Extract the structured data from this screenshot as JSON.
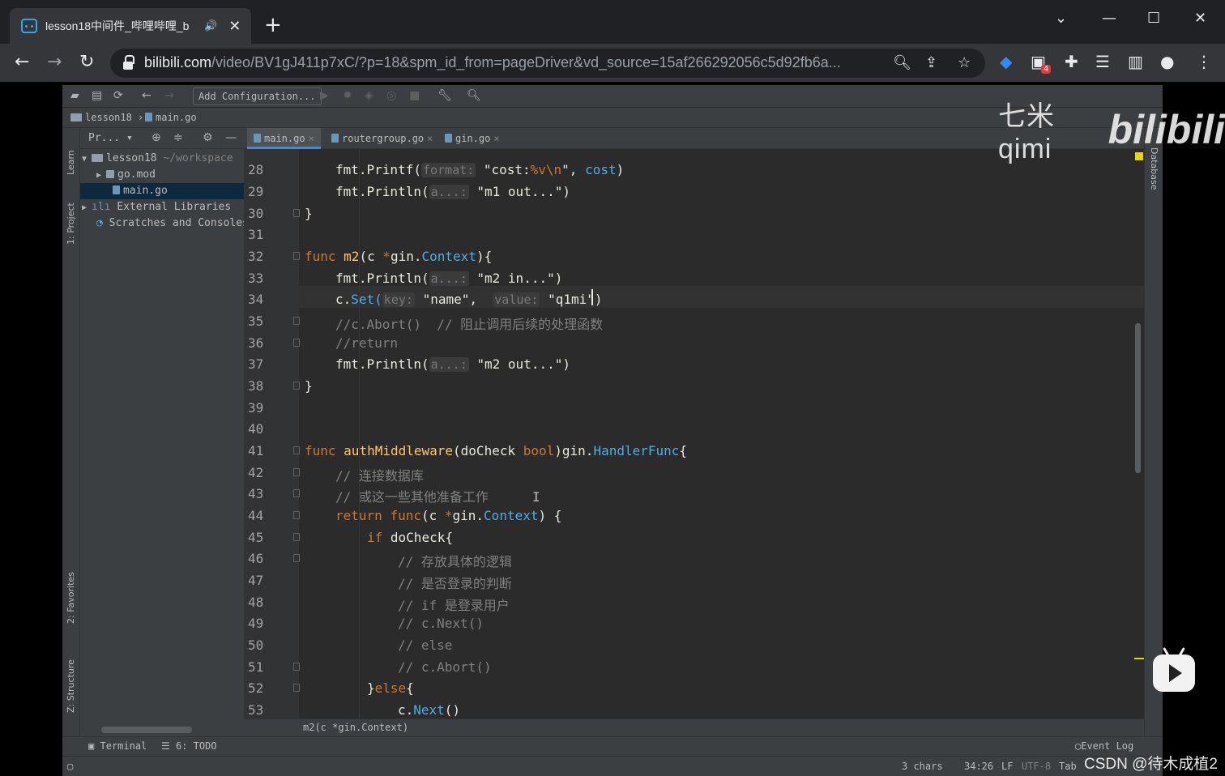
{
  "browser": {
    "tab_title": "lesson18中间件_哔哩哔哩_b",
    "url_host": "bilibili.com",
    "url_path": "/video/BV1gJ411p7xC/?p=18&spm_id_from=pageDriver&vd_source=15af266292056c5d92fb6a...",
    "extension_badge": "4"
  },
  "ide": {
    "toolbar": {
      "add_configuration": "Add Configuration..."
    },
    "nav": {
      "project": "lesson18",
      "file": "main.go"
    },
    "left_stripe": {
      "learn": "Learn",
      "project": "1: Project",
      "favorites": "2: Favorites",
      "structure": "Z: Structure"
    },
    "right_stripe": {
      "database": "Database"
    },
    "project_panel": {
      "title": "Pr...",
      "tree": [
        {
          "arrow": "▼",
          "name": "lesson18",
          "hint": " ~/workspace"
        },
        {
          "arrow": "▶",
          "name": "go.mod",
          "hint": ""
        },
        {
          "arrow": "",
          "name": "main.go",
          "hint": ""
        },
        {
          "arrow": "▶",
          "name": "External Libraries",
          "hint": ""
        },
        {
          "arrow": "",
          "name": "Scratches and Consoles",
          "hint": ""
        }
      ]
    },
    "tabs": [
      "main.go",
      "routergroup.go",
      "gin.go"
    ],
    "line_numbers": [
      "28",
      "29",
      "30",
      "31",
      "32",
      "33",
      "34",
      "35",
      "36",
      "37",
      "38",
      "39",
      "40",
      "41",
      "42",
      "43",
      "44",
      "45",
      "46",
      "47",
      "48",
      "49",
      "50",
      "51",
      "52",
      "53"
    ],
    "code": {
      "l28": {
        "pkg": "fmt.",
        "fn": "Printf(",
        "hint": "format:",
        "s1": "\"cost:",
        "esc": "%v\\n",
        "s2": "\"",
        "rest": ", ",
        "var": "cost",
        "end": ")"
      },
      "l29": {
        "pkg": "fmt.",
        "fn": "Println(",
        "hint": "a...:",
        "str": "\"m1 out...\"",
        "end": ")"
      },
      "l30": "}",
      "l32": {
        "kw": "func ",
        "fn": "m2",
        "p1": "(c ",
        "star": "*",
        "pkg": "gin.",
        "typ": "Context",
        "end": "){"
      },
      "l33": {
        "pkg": "fmt.",
        "fn": "Println(",
        "hint": "a...:",
        "str": "\"m2 in...\"",
        "end": ")"
      },
      "l34": {
        "pkg": "c.",
        "fn": "Set(",
        "hint1": "key:",
        "str1": "\"name\"",
        "comma": ",",
        "hint2": "value:",
        "str2": "\"q1mi\"",
        "end": ")"
      },
      "l35": "//c.Abort()  // 阻止调用后续的处理函数",
      "l36": "//return",
      "l37": {
        "pkg": "fmt.",
        "fn": "Println(",
        "hint": "a...:",
        "str": "\"m2 out...\"",
        "end": ")"
      },
      "l38": "}",
      "l41": {
        "kw": "func ",
        "fn": "authMiddleware",
        "p1": "(doCheck ",
        "bool": "bool",
        "p2": ")",
        "pkg": "gin.",
        "typ": "HandlerFunc",
        "end": "{"
      },
      "l42": "// 连接数据库",
      "l43": "// 或这一些其他准备工作",
      "l44": {
        "kw": "return ",
        "kw2": "func",
        "p1": "(c ",
        "star": "*",
        "pkg": "gin.",
        "typ": "Context",
        "end": ") {"
      },
      "l45": {
        "kw": "if ",
        "rest": "doCheck{"
      },
      "l46": "// 存放具体的逻辑",
      "l47": "// 是否登录的判断",
      "l48": "// if 是登录用户",
      "l49": "// c.Next()",
      "l50": "// else",
      "l51": "// c.Abort()",
      "l52": {
        "b1": "}",
        "kw": "else",
        "b2": "{"
      },
      "l53": {
        "pkg": "c.",
        "fn": "Next",
        "end": "()"
      }
    },
    "editor_breadcrumb": "m2(c *gin.Context)",
    "bottom_tools": {
      "terminal": "Terminal",
      "todo": "6: TODO",
      "event_log": "Event Log"
    },
    "status": {
      "chars": "3 chars",
      "position": "34:26",
      "line_sep": "LF",
      "encoding": "UTF-8",
      "indent": "Tab"
    }
  },
  "overlay": {
    "watermark_left": "七米qimi",
    "watermark_right": "bilibili",
    "csdn": "CSDN @待木成植2"
  }
}
